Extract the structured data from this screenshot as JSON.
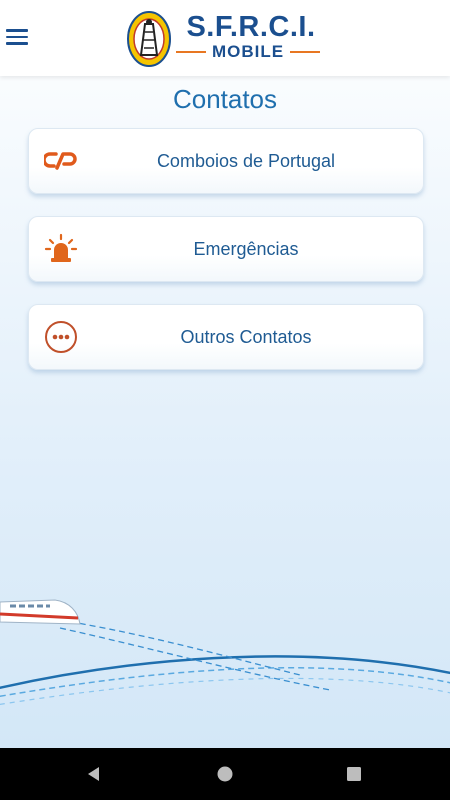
{
  "app": {
    "logo_title": "S.F.R.C.I.",
    "logo_subtitle": "MOBILE"
  },
  "page": {
    "title": "Contatos"
  },
  "contacts": [
    {
      "label": "Comboios de Portugal",
      "icon": "cp-logo-icon"
    },
    {
      "label": "Emergências",
      "icon": "siren-icon"
    },
    {
      "label": "Outros Contatos",
      "icon": "more-dots-icon"
    }
  ],
  "colors": {
    "brand_blue": "#1b4f8f",
    "accent_orange": "#e87722",
    "label_blue": "#1f5b93"
  },
  "system_nav": [
    "back-icon",
    "home-icon",
    "recents-icon"
  ]
}
